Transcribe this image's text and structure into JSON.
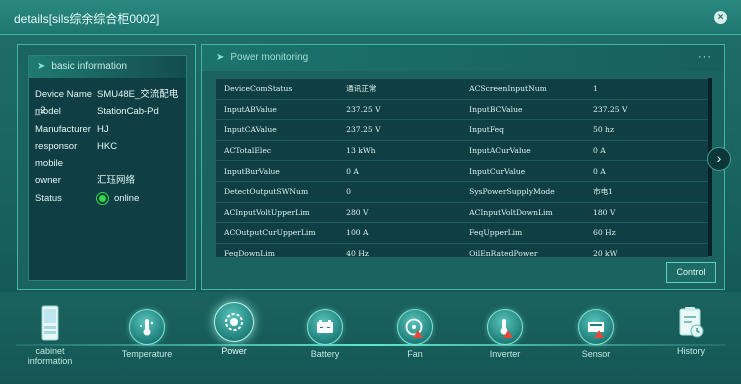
{
  "window": {
    "title": "details[sils综余综合柜0002]"
  },
  "basic": {
    "header": "basic information",
    "rows": [
      {
        "label": "Device Name",
        "value": "SMU48E_交流配电_2"
      },
      {
        "label": "model",
        "value": "StationCab-Pd"
      },
      {
        "label": "Manufacturer",
        "value": "HJ"
      },
      {
        "label": "responsor",
        "value": "HKC"
      },
      {
        "label": "mobile",
        "value": ""
      },
      {
        "label": "owner",
        "value": "汇珏网络"
      },
      {
        "label": "Status",
        "value": "online"
      }
    ]
  },
  "monitor": {
    "header": "Power monitoring",
    "more": "···",
    "rows": [
      {
        "k1": "DeviceComStatus",
        "v1": "通讯正常",
        "k2": "ACScreenInputNum",
        "v2": "1"
      },
      {
        "k1": "InputABValue",
        "v1": "237.25 V",
        "k2": "InputBCValue",
        "v2": "237.25 V"
      },
      {
        "k1": "InputCAValue",
        "v1": "237.25 V",
        "k2": "InputFeq",
        "v2": "50 hz"
      },
      {
        "k1": "ACTotalElec",
        "v1": "13 kWh",
        "k2": "InputACurValue",
        "v2": "0 A"
      },
      {
        "k1": "InputBurValue",
        "v1": "0 A",
        "k2": "InputCurValue",
        "v2": "0 A"
      },
      {
        "k1": "DetectOutputSWNum",
        "v1": "0",
        "k2": "SysPowerSupplyMode",
        "v2": "市电1"
      },
      {
        "k1": "ACInputVoltUpperLim",
        "v1": "280 V",
        "k2": "ACInputVoltDownLim",
        "v2": "180 V"
      },
      {
        "k1": "ACOutputCurUpperLim",
        "v1": "100 A",
        "k2": "FeqUpperLim",
        "v2": "60 Hz"
      },
      {
        "k1": "FeqDownLim",
        "v1": "40 Hz",
        "k2": "OilEnRatedPower",
        "v2": "20 kW"
      }
    ]
  },
  "buttons": {
    "control": "Control",
    "close": "×",
    "next": "›"
  },
  "nav": [
    {
      "label": "cabinet\ninformation",
      "icon": "cabinet-icon"
    },
    {
      "label": "Temperature",
      "icon": "thermometer-icon"
    },
    {
      "label": "Power",
      "icon": "power-icon"
    },
    {
      "label": "Battery",
      "icon": "battery-icon"
    },
    {
      "label": "Fan",
      "icon": "fan-icon"
    },
    {
      "label": "Inverter",
      "icon": "inverter-icon"
    },
    {
      "label": "Sensor",
      "icon": "sensor-icon"
    },
    {
      "label": "History",
      "icon": "history-icon"
    }
  ],
  "colors": {
    "accent": "#3fb7a8",
    "online": "#33d84a",
    "background": "#155a5a"
  }
}
